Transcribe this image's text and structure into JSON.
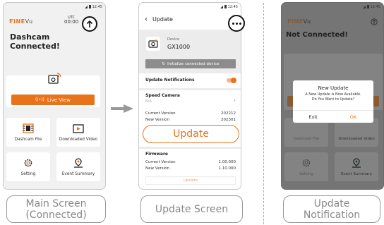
{
  "status_time": "12:45",
  "logo": {
    "part1": "FINE",
    "part2": "Vu"
  },
  "colors": {
    "accent": "#e8731a",
    "dark_overlay": "#757575"
  },
  "main": {
    "utc_label": "UTC",
    "utc_time": "00:00",
    "title_line1": "Dashcam",
    "title_line2": "Connected!",
    "live_view": "Live View",
    "grid": [
      "Dashcam File",
      "Downloaded Video",
      "Setting",
      "Event Summary"
    ]
  },
  "update_screen": {
    "header_title": "Update",
    "device_label": "Device",
    "device_model": "GX1000",
    "init_button": "Initialize connected device",
    "notifications_label": "Update Notifications",
    "speed_camera_label": "Speed Camera",
    "speed_camera_value": "N/A",
    "current_version_label": "Current Version",
    "current_version_value": "202212",
    "new_version_label": "New Version",
    "new_version_value": "202301",
    "update_button": "Update",
    "firmware_label": "Firmware",
    "fw_current_label": "Current Version",
    "fw_current_value": "1.00.000",
    "fw_new_label": "New Version",
    "fw_new_value": "1.10.000",
    "fw_update_button": "Update"
  },
  "notification_screen": {
    "title": "Not Connected!",
    "dialog_title": "New Update",
    "dialog_msg_line1": "A New Update is Now Available.",
    "dialog_msg_line2": "Do You Want to Update?",
    "exit": "Exit",
    "ok": "OK",
    "bg_labels": [
      "Dashcam File",
      "Downloaded Video",
      "Setting",
      "Event Summary"
    ]
  },
  "captions": {
    "main_line1": "Main Screen",
    "main_line2": "(Connected)",
    "update": "Update Screen",
    "notif_line1": "Update",
    "notif_line2": "Notification"
  }
}
